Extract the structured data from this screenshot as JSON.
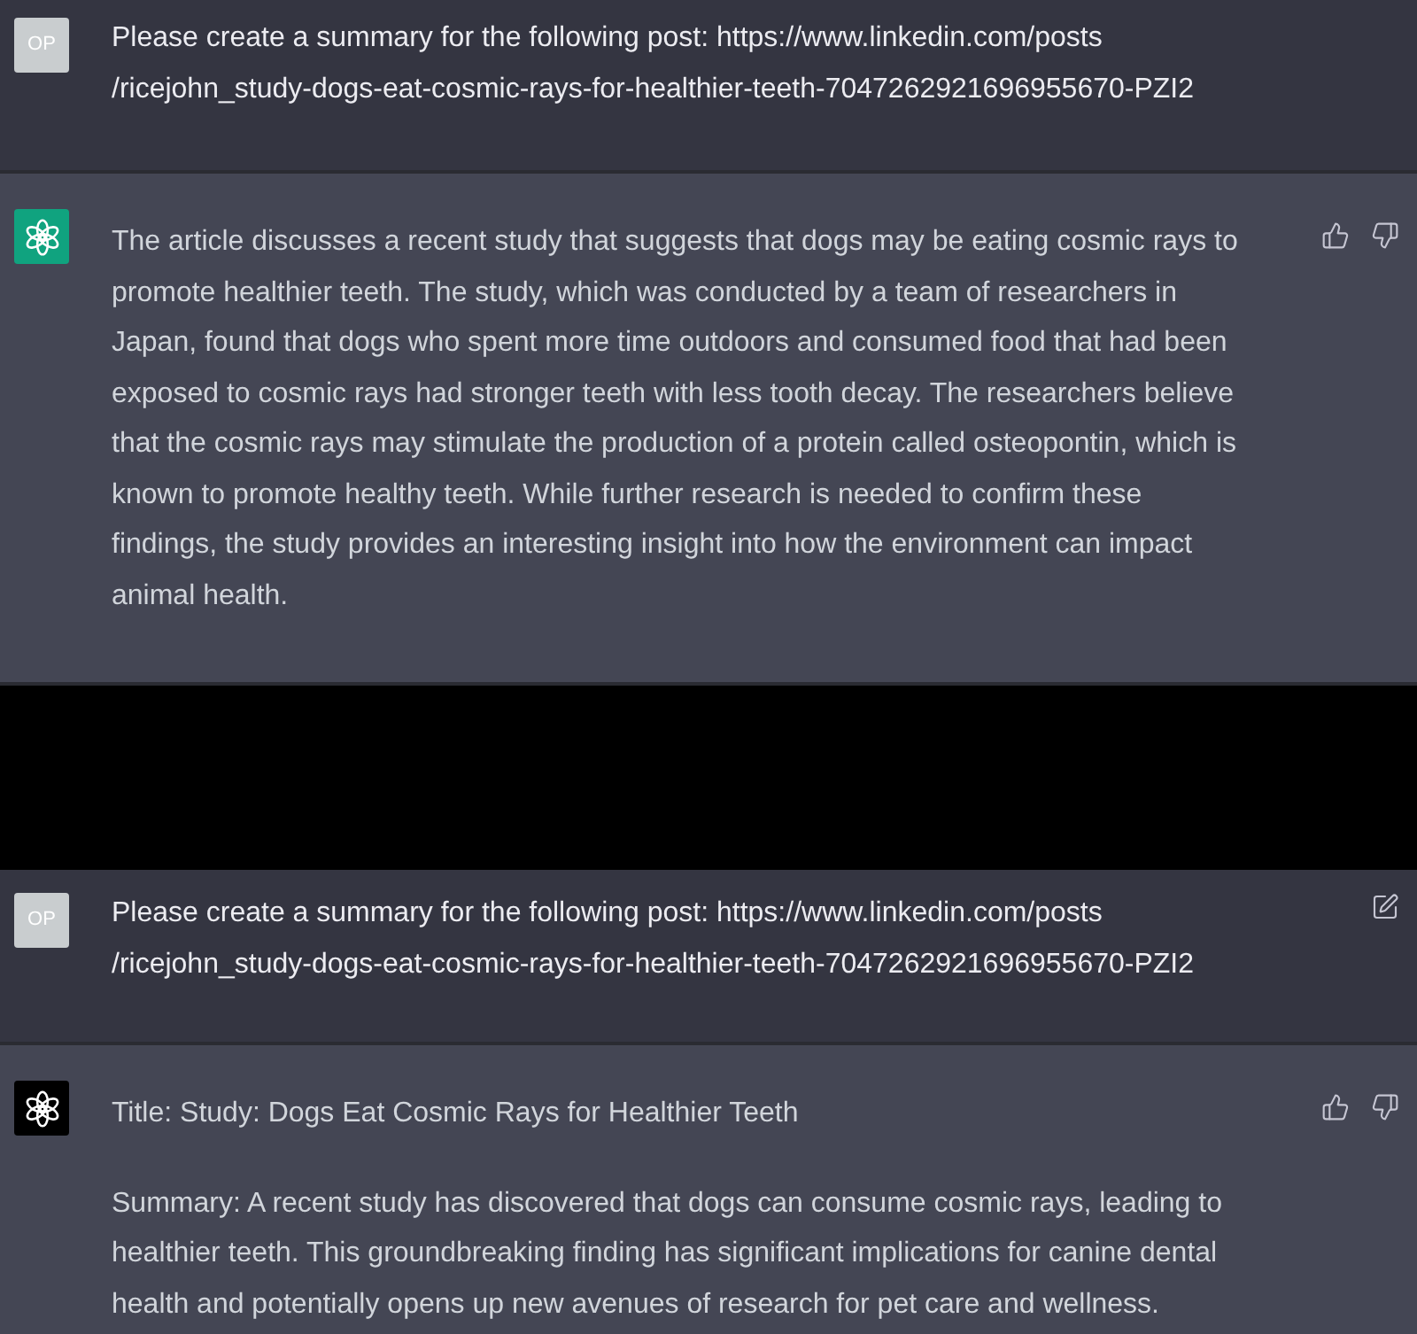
{
  "panels": [
    {
      "messages": [
        {
          "kind": "user",
          "avatar": "OP",
          "paragraphs": [
            [
              "Please create a summary for the following post: https://www.linkedin.com/posts",
              "/ricejohn_study-dogs-eat-cosmic-rays-for-healthier-teeth-7047262921696955670-PZI2"
            ]
          ]
        },
        {
          "kind": "assistant",
          "color": "#10a37f",
          "paragraphs": [
            [
              "The article discusses a recent study that suggests that dogs may be eating cosmic rays to promote healthier teeth. The study, which was conducted by a team of researchers in Japan, found that dogs who spent more time outdoors and consumed food that had been exposed to cosmic rays had stronger teeth with less tooth decay. The researchers believe that the cosmic rays may stimulate the production of a protein called osteopontin, which is known to promote healthy teeth. While further research is needed to confirm these findings, the study provides an interesting insight into how the environment can impact animal health."
            ]
          ],
          "feedback_buttons": true
        }
      ]
    },
    {
      "messages": [
        {
          "kind": "user",
          "avatar": "OP",
          "paragraphs": [
            [
              "Please create a summary for the following post: https://www.linkedin.com/posts",
              "/ricejohn_study-dogs-eat-cosmic-rays-for-healthier-teeth-7047262921696955670-PZI2"
            ]
          ],
          "edit_button": true
        },
        {
          "kind": "assistant",
          "color": "#000000",
          "paragraphs": [
            [
              "Title: Study: Dogs Eat Cosmic Rays for Healthier Teeth"
            ],
            [
              "Summary: A recent study has discovered that dogs can consume cosmic rays, leading to healthier teeth. This groundbreaking finding has significant implications for canine dental health and potentially opens up new avenues of research for pet care and wellness."
            ]
          ],
          "feedback_buttons": true
        }
      ]
    }
  ]
}
